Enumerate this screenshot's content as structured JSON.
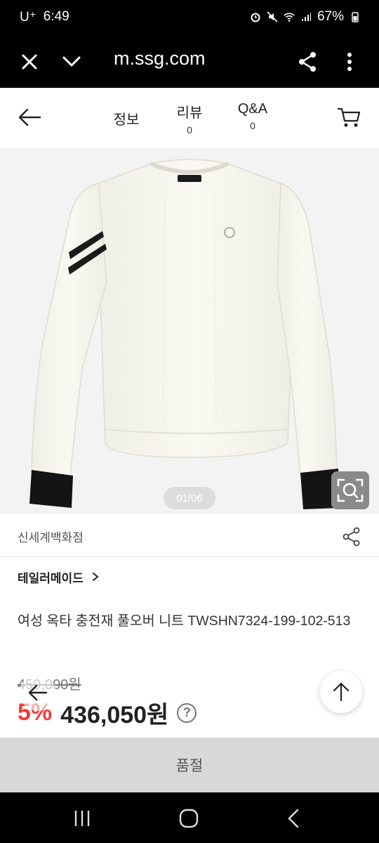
{
  "status_bar": {
    "carrier": "U⁺",
    "time": "6:49",
    "battery": "67%"
  },
  "browser": {
    "url": "m.ssg.com"
  },
  "header": {
    "tabs": [
      {
        "label": "정보",
        "count": ""
      },
      {
        "label": "리뷰",
        "count": "0"
      },
      {
        "label": "Q&A",
        "count": "0"
      }
    ]
  },
  "gallery": {
    "counter": "01/06"
  },
  "store": {
    "name": "신세계백화점"
  },
  "product": {
    "brand": "테일러메이드",
    "title": "여성 옥타 충전재 풀오버 니트 TWSHN7324-199-102-513",
    "original_price": "459,000원",
    "discount": "5%",
    "price": "436,050원"
  },
  "actions": {
    "soldout_label": "품절"
  },
  "colors": {
    "discount": "#f33a3a",
    "soldout_bg": "#d8d8d8"
  }
}
